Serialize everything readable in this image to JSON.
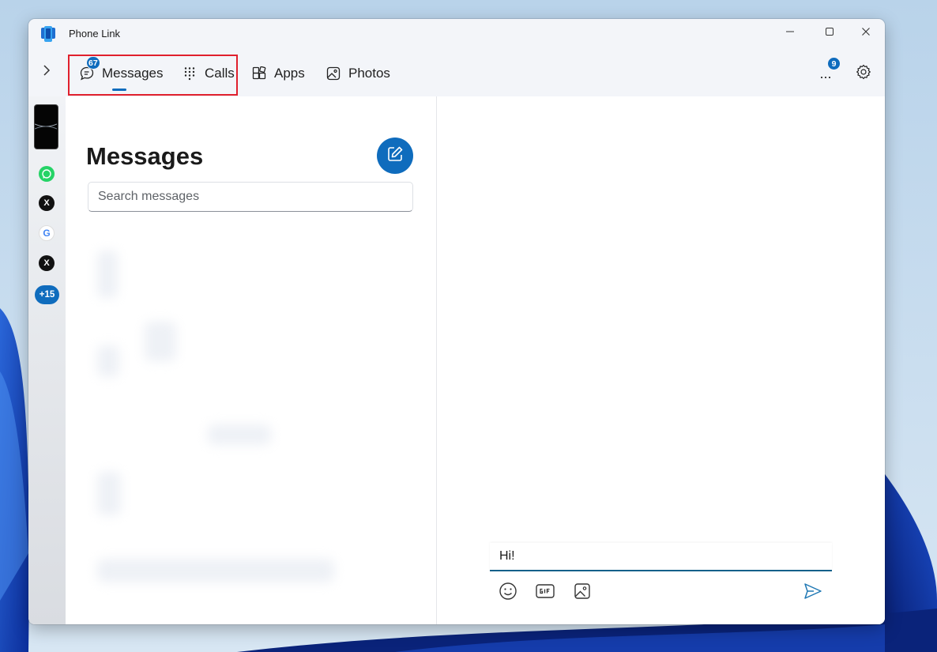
{
  "window": {
    "title": "Phone Link"
  },
  "nav": {
    "tabs": [
      {
        "label": "Messages",
        "icon": "chat-icon",
        "badge": "67",
        "selected": true
      },
      {
        "label": "Calls",
        "icon": "dialpad-icon",
        "selected": false
      },
      {
        "label": "Apps",
        "icon": "apps-icon",
        "selected": false
      },
      {
        "label": "Photos",
        "icon": "photos-icon",
        "selected": false
      }
    ],
    "more_badge": "9",
    "more_label": "..."
  },
  "rail": {
    "notification_apps": [
      "whatsapp-icon",
      "x-icon",
      "google-icon",
      "x-icon"
    ],
    "x_glyph": "X",
    "google_glyph": "G",
    "more_apps_label": "+15"
  },
  "messages": {
    "title": "Messages",
    "search_placeholder": "Search messages"
  },
  "conversation": {
    "compose_value": "Hi!"
  },
  "colors": {
    "accent": "#0f6cbd",
    "highlight": "#e0202d",
    "composer_underline": "#11608a"
  }
}
